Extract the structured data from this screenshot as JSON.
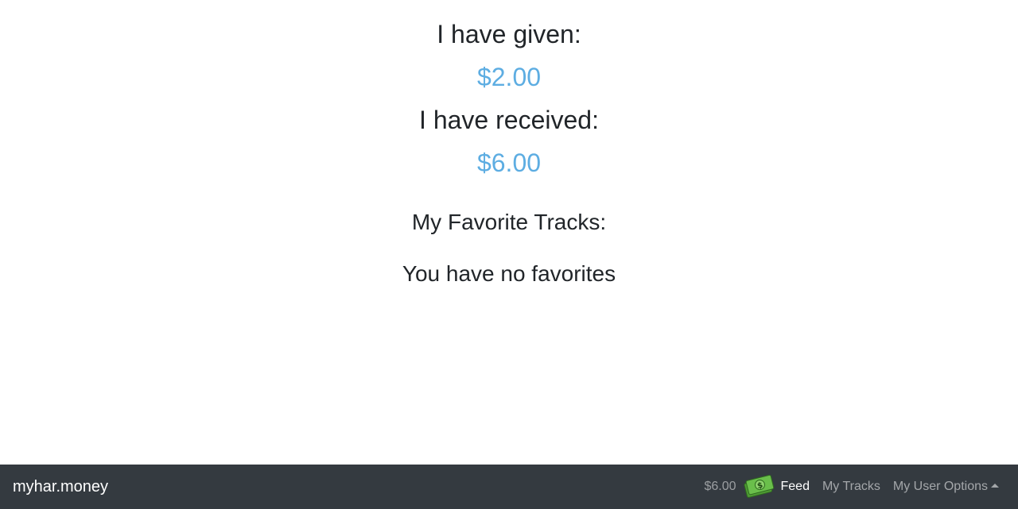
{
  "stats": {
    "given_label": "I have given:",
    "given_value": "$2.00",
    "received_label": "I have received:",
    "received_value": "$6.00"
  },
  "favorites": {
    "title": "My Favorite Tracks:",
    "empty_message": "You have no favorites"
  },
  "navbar": {
    "brand": "myhar.money",
    "balance": "$6.00",
    "balance_icon": "money-icon",
    "links": [
      {
        "label": "Feed",
        "active": true
      },
      {
        "label": "My Tracks",
        "active": false
      },
      {
        "label": "My User Options",
        "active": false
      }
    ]
  },
  "colors": {
    "accent": "#5dade2",
    "navbar_bg": "#343a40",
    "money_green": "#6abf4b"
  }
}
